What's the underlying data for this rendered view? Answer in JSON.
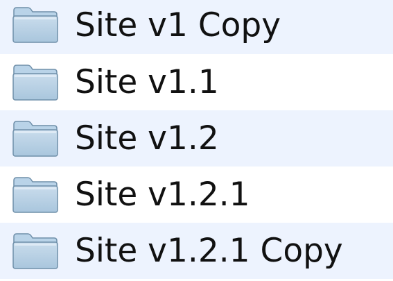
{
  "files": [
    {
      "name": "Site v1 Copy",
      "icon": "folder-icon"
    },
    {
      "name": "Site v1.1",
      "icon": "folder-icon"
    },
    {
      "name": "Site v1.2",
      "icon": "folder-icon"
    },
    {
      "name": "Site v1.2.1",
      "icon": "folder-icon"
    },
    {
      "name": "Site v1.2.1 Copy",
      "icon": "folder-icon"
    }
  ],
  "colors": {
    "row_even": "#edf3fe",
    "row_odd": "#ffffff",
    "folder_body": "#a9c6dd",
    "folder_tab": "#b9d3e8",
    "folder_edge": "#6f8fa9"
  }
}
